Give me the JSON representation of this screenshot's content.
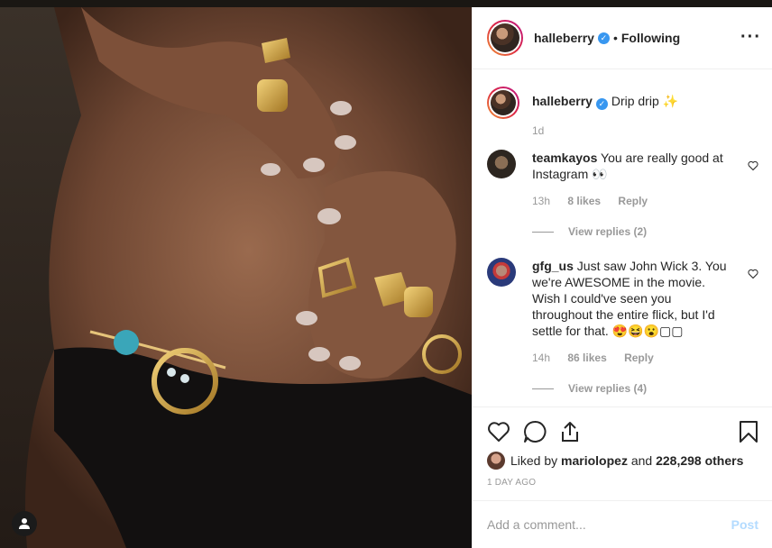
{
  "header": {
    "username": "halleberry",
    "separator": "•",
    "follow_status": "Following",
    "more": "···"
  },
  "caption": {
    "username": "halleberry",
    "text": "Drip drip ✨",
    "time": "1d"
  },
  "comments": [
    {
      "username": "teamkayos",
      "text": "You are really good at Instagram 👀",
      "time": "13h",
      "likes": "8 likes",
      "reply": "Reply",
      "view_replies": "View replies (2)"
    },
    {
      "username": "gfg_us",
      "text": "Just saw John Wick 3. You we're AWESOME in the movie. Wish I could've seen you throughout the entire flick, but I'd settle for that. 😍😆😮▢▢",
      "time": "14h",
      "likes": "86 likes",
      "reply": "Reply",
      "view_replies": "View replies (4)"
    }
  ],
  "likes": {
    "prefix": "Liked by",
    "user": "mariolopez",
    "connector": "and",
    "others": "228,298 others"
  },
  "posted_ago": "1 DAY AGO",
  "add_comment": {
    "placeholder": "Add a comment...",
    "post_label": "Post"
  },
  "colors": {
    "accent": "#3897f0",
    "post_disabled": "#b3dbff",
    "muted": "#999999",
    "text": "#262626"
  },
  "icons": [
    "heart-icon",
    "comment-icon",
    "share-icon",
    "bookmark-icon",
    "user-tag-icon",
    "verified-icon",
    "more-icon"
  ]
}
